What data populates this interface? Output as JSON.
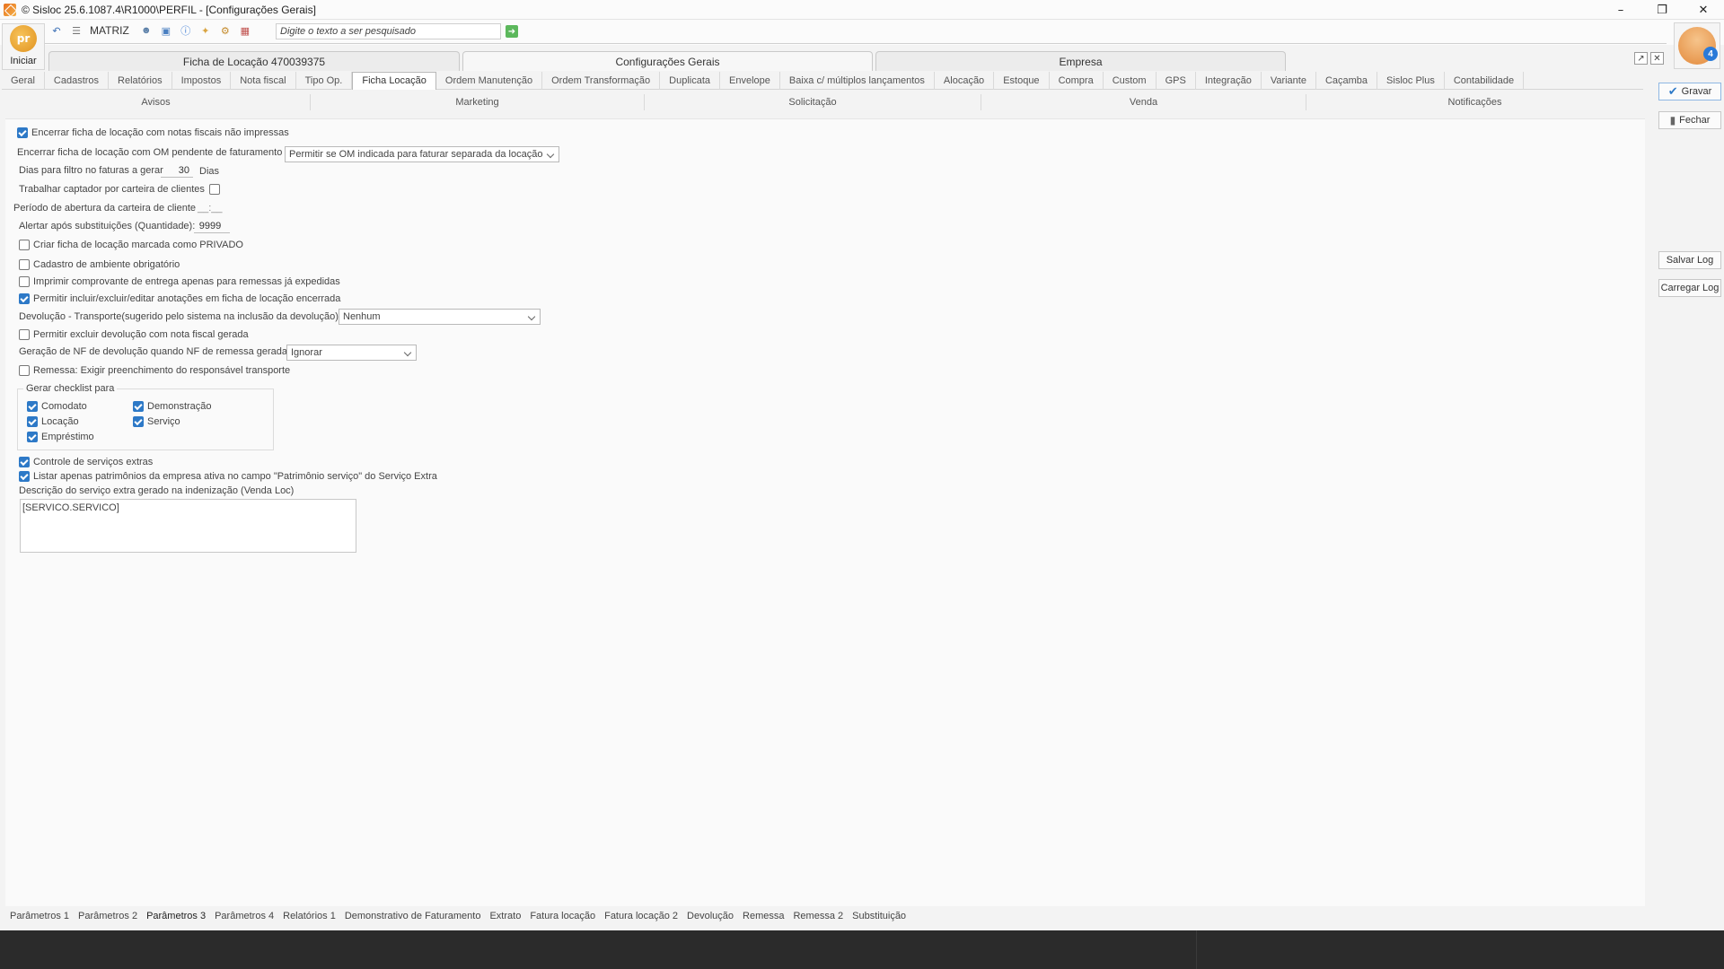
{
  "window": {
    "title": "© Sisloc 25.6.1087.4\\R1000\\PERFIL - [Configurações Gerais]"
  },
  "toolbar": {
    "iniciar_label": "Iniciar",
    "matriz_label": "MATRIZ",
    "search_placeholder": "Digite o texto a ser pesquisado",
    "notification_count": "4"
  },
  "doc_tabs": [
    {
      "label": "Ficha de Locação 470039375"
    },
    {
      "label": "Configurações Gerais"
    },
    {
      "label": "Empresa"
    }
  ],
  "category_tabs": [
    "Geral",
    "Cadastros",
    "Relatórios",
    "Impostos",
    "Nota fiscal",
    "Tipo Op.",
    "Ficha Locação",
    "Ordem Manutenção",
    "Ordem Transformação",
    "Duplicata",
    "Envelope",
    "Baixa c/ múltiplos lançamentos",
    "Alocação",
    "Estoque",
    "Compra",
    "Custom",
    "GPS",
    "Integração",
    "Variante",
    "Caçamba",
    "Sisloc Plus",
    "Contabilidade"
  ],
  "sub_tabs": [
    "Avisos",
    "Marketing",
    "Solicitação",
    "Venda",
    "Notificações"
  ],
  "buttons": {
    "gravar": "Gravar",
    "fechar": "Fechar",
    "salvar_log": "Salvar Log",
    "carregar_log": "Carregar Log"
  },
  "form": {
    "encerrar_nf": "Encerrar ficha de locação com notas fiscais não impressas",
    "encerrar_om_label": "Encerrar ficha de locação com OM pendente de faturamento",
    "encerrar_om_value": "Permitir se OM indicada para faturar separada da locação",
    "dias_label": "Dias para filtro no faturas a gerar",
    "dias_value": "30",
    "dias_unit": "Dias",
    "captador_label": "Trabalhar captador por carteira de clientes",
    "periodo_label": "Período de abertura da carteira de cliente",
    "periodo_value": "__:__",
    "alertar_label": "Alertar após substituições (Quantidade):",
    "alertar_value": "9999",
    "privado": "Criar ficha de locação marcada como PRIVADO",
    "ambiente": "Cadastro de ambiente obrigatório",
    "comprovante": "Imprimir comprovante de entrega apenas para remessas já expedidas",
    "anotacoes": "Permitir incluir/excluir/editar anotações em ficha de locação encerrada",
    "devolucao_label": "Devolução - Transporte(sugerido pelo sistema na inclusão da devolução)",
    "devolucao_value": "Nenhum",
    "excluir_devolucao": "Permitir excluir devolução com nota fiscal gerada",
    "geracao_nf_label": "Geração de NF de devolução quando NF de remessa gerada",
    "geracao_nf_value": "Ignorar",
    "remessa": "Remessa: Exigir preenchimento do responsável transporte",
    "checklist_title": "Gerar checklist para",
    "checklist": {
      "comodato": "Comodato",
      "demonstracao": "Demonstração",
      "locacao": "Locação",
      "servico": "Serviço",
      "emprestimo": "Empréstimo"
    },
    "controle_servicos": "Controle de serviços extras",
    "listar_patrimonios": "Listar apenas patrimônios da empresa ativa no campo \"Patrimônio serviço\" do Serviço Extra",
    "descricao_label": "Descrição do serviço extra gerado na indenização (Venda Loc)",
    "descricao_value": "[SERVICO.SERVICO]"
  },
  "bottom_tabs": [
    "Parâmetros 1",
    "Parâmetros 2",
    "Parâmetros 3",
    "Parâmetros 4",
    "Relatórios 1",
    "Demonstrativo de Faturamento",
    "Extrato",
    "Fatura locação",
    "Fatura locação 2",
    "Devolução",
    "Remessa",
    "Remessa 2",
    "Substituição"
  ]
}
